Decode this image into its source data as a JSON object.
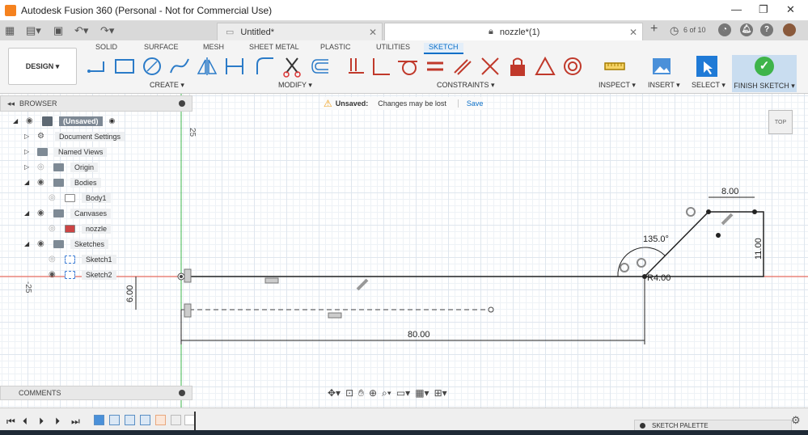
{
  "window": {
    "title": "Autodesk Fusion 360 (Personal - Not for Commercial Use)",
    "minimize": "—",
    "maximize": "❐",
    "close": "✕"
  },
  "tabs": [
    {
      "label": "Untitled*",
      "close": "✕"
    },
    {
      "label": "nozzle*(1)",
      "close": "✕"
    }
  ],
  "tabbar_right": {
    "add": "+",
    "page_count": "6 of 10"
  },
  "ribbon": {
    "tabs": [
      "SOLID",
      "SURFACE",
      "MESH",
      "SHEET METAL",
      "PLASTIC",
      "UTILITIES",
      "SKETCH"
    ],
    "active_tab": "SKETCH",
    "workspace": "DESIGN ▾",
    "groups": {
      "create": "CREATE ▾",
      "modify": "MODIFY ▾",
      "constraints": "CONSTRAINTS ▾",
      "inspect": "INSPECT ▾",
      "insert": "INSERT ▾",
      "select": "SELECT ▾",
      "finish": "FINISH SKETCH ▾"
    },
    "accent": "#0b6fc7"
  },
  "browser": {
    "title": "BROWSER",
    "root": "(Unsaved)",
    "items": [
      {
        "label": "Document Settings",
        "icon": "gear-icon"
      },
      {
        "label": "Named Views",
        "icon": "folder-icon"
      },
      {
        "label": "Origin",
        "icon": "folder-icon"
      },
      {
        "label": "Bodies",
        "icon": "folder-icon"
      },
      {
        "label": "Body1",
        "icon": "body-icon"
      },
      {
        "label": "Canvases",
        "icon": "folder-icon"
      },
      {
        "label": "nozzle",
        "icon": "image-icon"
      },
      {
        "label": "Sketches",
        "icon": "folder-icon"
      },
      {
        "label": "Sketch1",
        "icon": "sketch-icon"
      },
      {
        "label": "Sketch2",
        "icon": "sketch-icon"
      }
    ]
  },
  "notice": {
    "label": "Unsaved:",
    "message": "Changes may be lost",
    "action": "Save"
  },
  "viewcube": "TOP",
  "sketch": {
    "dims": {
      "length": "80.00",
      "height": "6.00",
      "top": "8.00",
      "right": "11.00",
      "angle": "135.0°",
      "radius": "R4.00"
    },
    "axis_top": "25",
    "axis_left": "-25"
  },
  "comments": "COMMENTS",
  "sketch_palette": "SKETCH PALETTE"
}
